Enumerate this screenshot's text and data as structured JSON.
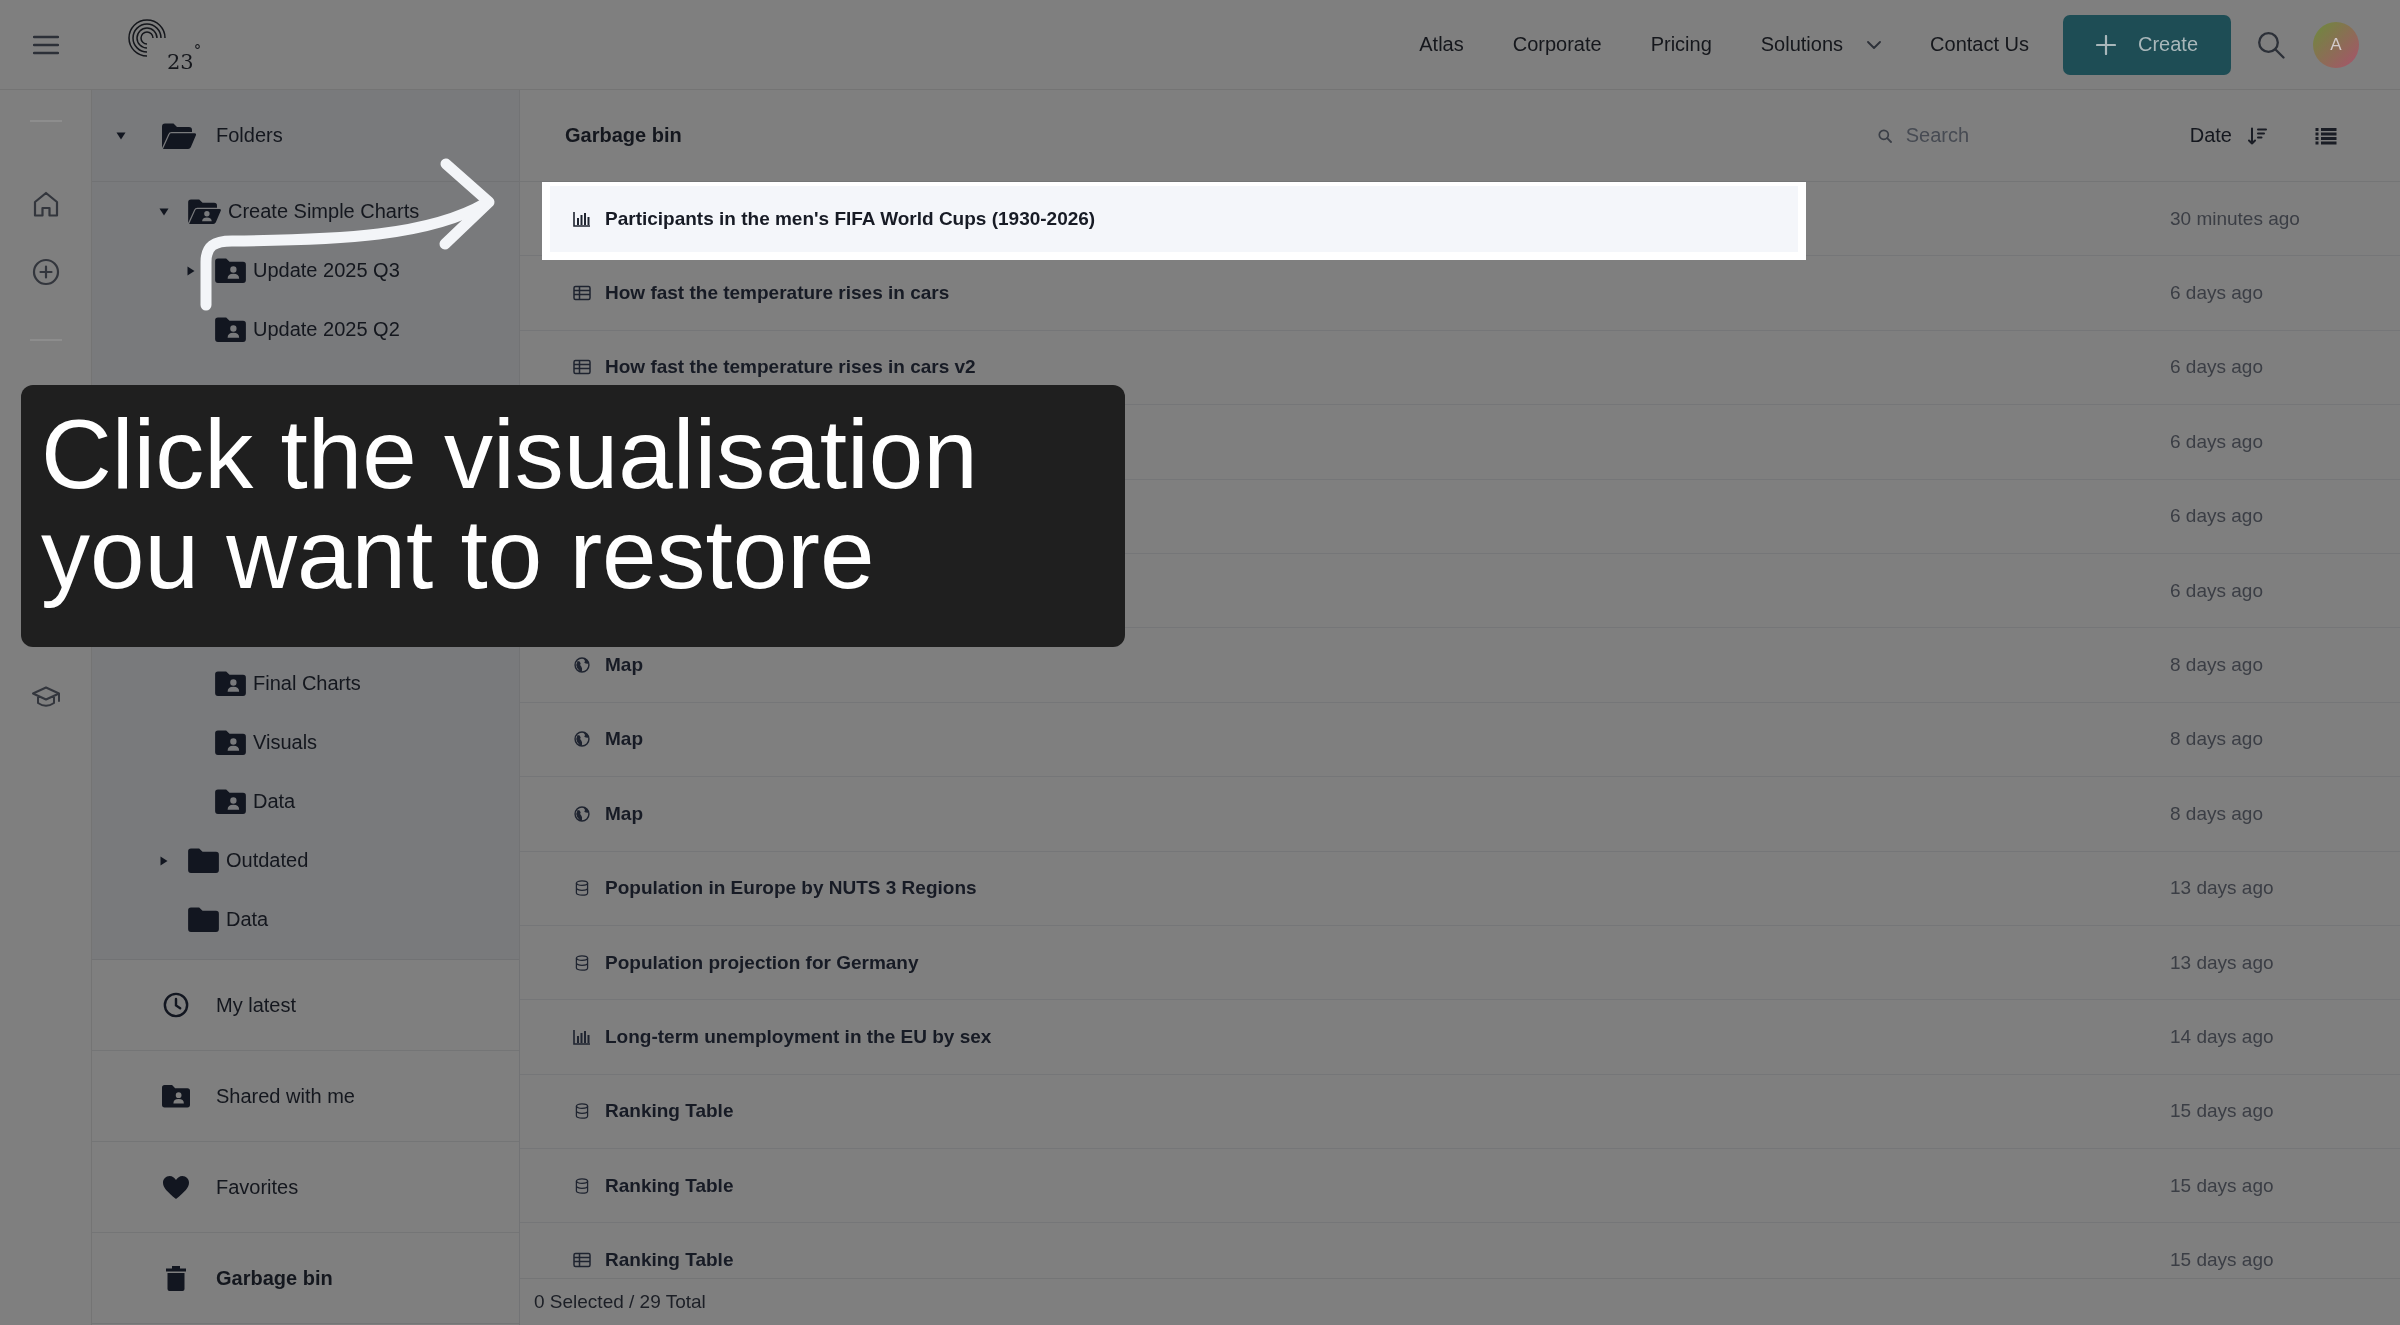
{
  "topbar": {
    "logo_text": "23$^{°}$",
    "nav": [
      {
        "label": "Atlas",
        "kind": "link"
      },
      {
        "label": "Corporate",
        "kind": "link"
      },
      {
        "label": "Pricing",
        "kind": "link"
      },
      {
        "label": "Solutions",
        "kind": "dropdown"
      },
      {
        "label": "Contact Us",
        "kind": "link"
      }
    ],
    "create_button": "Create",
    "avatar": "A"
  },
  "sidebar": {
    "folders_header": {
      "label": "Folders",
      "expanded": true
    },
    "tree": [
      {
        "label": "Create Simple Charts",
        "kind": "shared_folder",
        "expanded": true,
        "children": [
          {
            "label": "Update 2025 Q3",
            "kind": "shared_folder",
            "expanded": false
          },
          {
            "label": "Update 2025 Q2",
            "kind": "shared_folder"
          },
          {
            "label": "Final Charts",
            "kind": "shared_folder"
          },
          {
            "label": "Visuals",
            "kind": "shared_folder"
          },
          {
            "label": "Data",
            "kind": "shared_folder"
          }
        ]
      },
      {
        "label": "Outdated",
        "kind": "folder",
        "expanded": false
      },
      {
        "label": "Data",
        "kind": "folder"
      }
    ],
    "nav": [
      {
        "label": "My latest",
        "kind": "latest",
        "selected": false
      },
      {
        "label": "Shared with me",
        "kind": "shared",
        "selected": false
      },
      {
        "label": "Favorites",
        "kind": "favorites",
        "selected": false
      },
      {
        "label": "Garbage bin",
        "kind": "trash",
        "selected": true
      }
    ]
  },
  "main": {
    "title": "Garbage bin",
    "search": {
      "placeholder": "Search"
    },
    "sort_label": "Date",
    "rows": [
      {
        "kind": "chart",
        "title": "Participants in the men's FIFA World Cups (1930-2026)",
        "date": "30 minutes ago",
        "highlighted": true
      },
      {
        "kind": "table",
        "title": "How fast the temperature rises in cars",
        "date": "6 days ago",
        "highlighted": false
      },
      {
        "kind": "table",
        "title": "How fast the temperature rises in cars v2",
        "date": "6 days ago",
        "highlighted": false
      },
      {
        "date": "6 days ago",
        "highlighted": false
      },
      {
        "date": "6 days ago",
        "highlighted": false
      },
      {
        "date": "6 days ago",
        "highlighted": false
      },
      {
        "kind": "map",
        "title": "Map",
        "date": "8 days ago",
        "highlighted": false
      },
      {
        "kind": "map",
        "title": "Map",
        "date": "8 days ago",
        "highlighted": false
      },
      {
        "kind": "map",
        "title": "Map",
        "date": "8 days ago",
        "highlighted": false
      },
      {
        "kind": "dataset",
        "title": "Population in Europe by NUTS 3 Regions",
        "date": "13 days ago",
        "highlighted": false
      },
      {
        "kind": "dataset",
        "title": "Population projection for Germany",
        "date": "13 days ago",
        "highlighted": false
      },
      {
        "kind": "chart",
        "title": "Long-term unemployment in the EU by sex",
        "date": "14 days ago",
        "highlighted": false
      },
      {
        "kind": "dataset",
        "title": "Ranking Table",
        "date": "15 days ago",
        "highlighted": false
      },
      {
        "kind": "dataset",
        "title": "Ranking Table",
        "date": "15 days ago",
        "highlighted": false
      },
      {
        "kind": "table",
        "title": "Ranking Table",
        "date": "15 days ago",
        "highlighted": false
      }
    ],
    "status": "0 Selected / 29 Total"
  },
  "tutorial": {
    "caption": "Click the visualisation you want to restore"
  }
}
